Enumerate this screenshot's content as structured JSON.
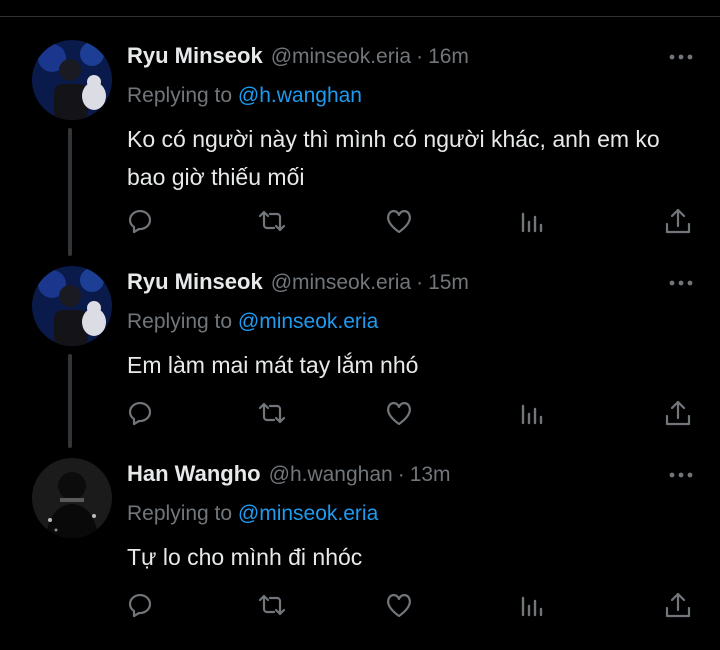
{
  "tweets": [
    {
      "name": "Ryu Minseok",
      "handle": "@minseok.eria",
      "separator": "·",
      "time": "16m",
      "replying_prefix": "Replying to ",
      "replying_to": "@h.wanghan",
      "text": "Ko có người này thì mình có người khác, anh em ko bao giờ thiếu mối"
    },
    {
      "name": "Ryu Minseok",
      "handle": "@minseok.eria",
      "separator": "·",
      "time": "15m",
      "replying_prefix": "Replying to ",
      "replying_to": "@minseok.eria",
      "text": "Em làm mai mát tay lắm nhó"
    },
    {
      "name": "Han Wangho",
      "handle": "@h.wanghan",
      "separator": "·",
      "time": "13m",
      "replying_prefix": "Replying to ",
      "replying_to": "@minseok.eria",
      "text": "Tự lo cho mình đi nhóc"
    }
  ],
  "icons": {
    "reply": "reply-icon",
    "retweet": "retweet-icon",
    "like": "like-icon",
    "views": "views-icon",
    "share": "share-icon",
    "more": "more-icon"
  },
  "colors": {
    "background": "#000000",
    "primary_text": "#e7e9ea",
    "secondary_text": "#71767b",
    "link": "#1d9bf0",
    "thread_line": "#333639"
  }
}
